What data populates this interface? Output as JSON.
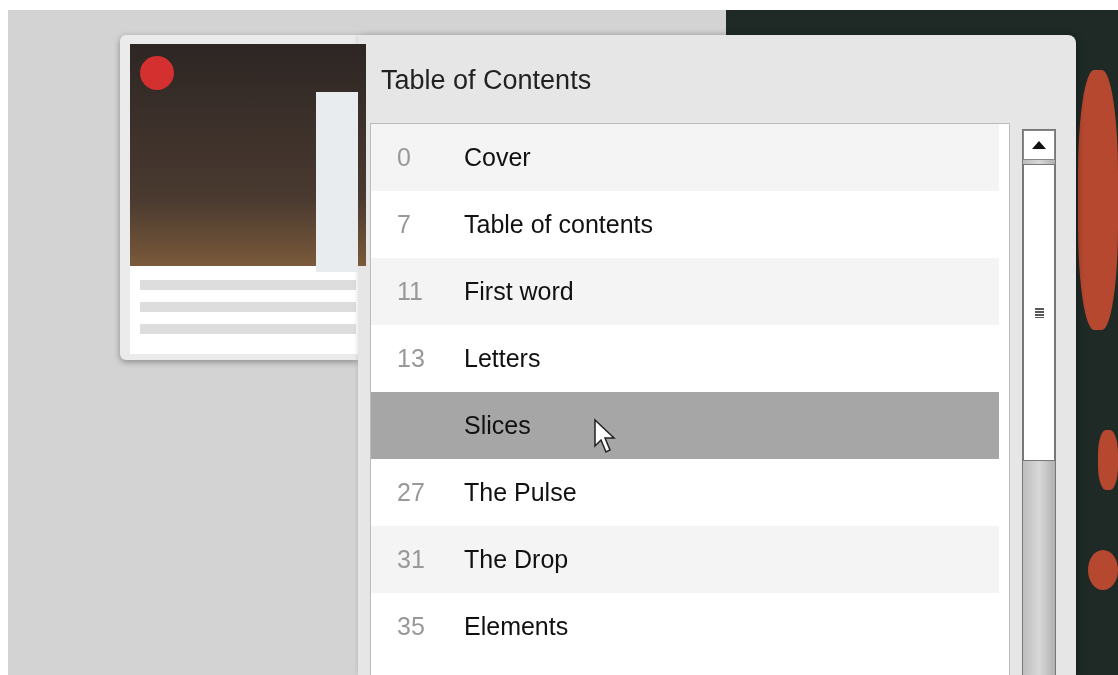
{
  "panel": {
    "title": "Table of Contents"
  },
  "toc": {
    "items": [
      {
        "page": "0",
        "label": "Cover",
        "selected": false
      },
      {
        "page": "7",
        "label": "Table of contents",
        "selected": false
      },
      {
        "page": "11",
        "label": "First word",
        "selected": false
      },
      {
        "page": "13",
        "label": "Letters",
        "selected": false
      },
      {
        "label": "Slices",
        "selected": true
      },
      {
        "page": "27",
        "label": "The Pulse",
        "selected": false
      },
      {
        "page": "31",
        "label": "The Drop",
        "selected": false
      },
      {
        "page": "35",
        "label": "Elements",
        "selected": false
      }
    ]
  }
}
